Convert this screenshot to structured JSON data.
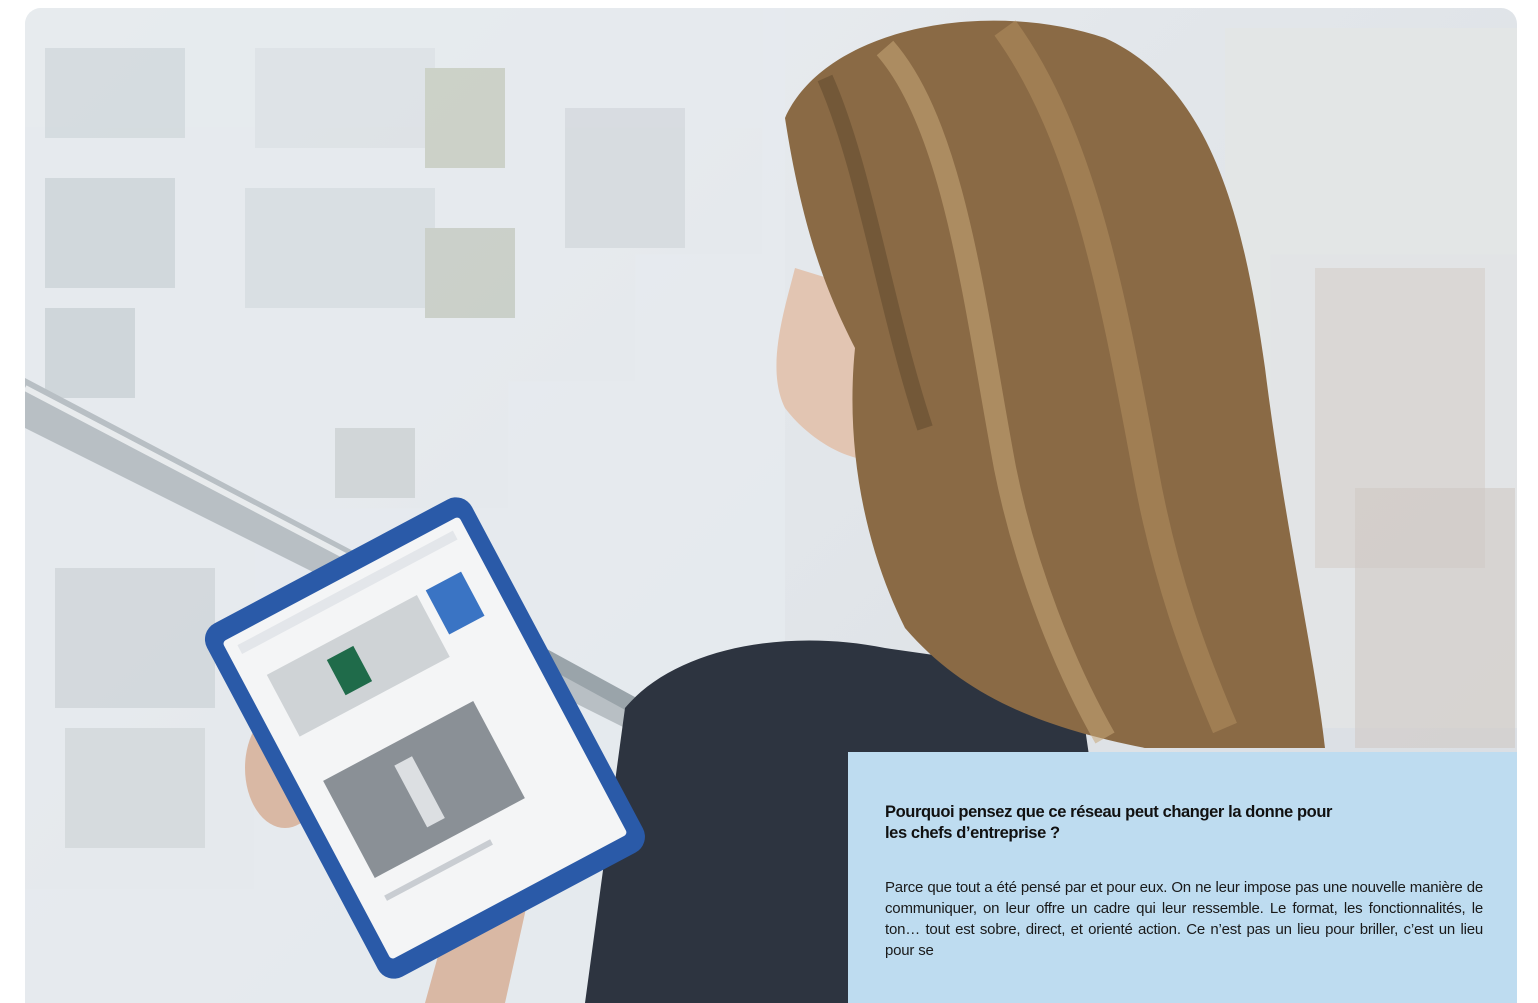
{
  "article": {
    "question": "Pourquoi pensez que ce réseau peut changer la donne pour les chefs d’entreprise ?",
    "answer": "Parce que tout a été pensé par et pour eux. On ne leur impose pas une nouvelle manière de communiquer, on leur offre un cadre qui leur ressemble. Le format, les fonctionnalités, le ton… tout est sobre, direct, et orienté action. Ce n’est pas un lieu pour briller, c’est un lieu pour se"
  },
  "photo": {
    "subject": "woman-with-tablet",
    "accent_colors": {
      "tablet_frame": "#2a5aa8",
      "caption_background": "#bedcf0",
      "hair": "#8a6a45"
    }
  }
}
